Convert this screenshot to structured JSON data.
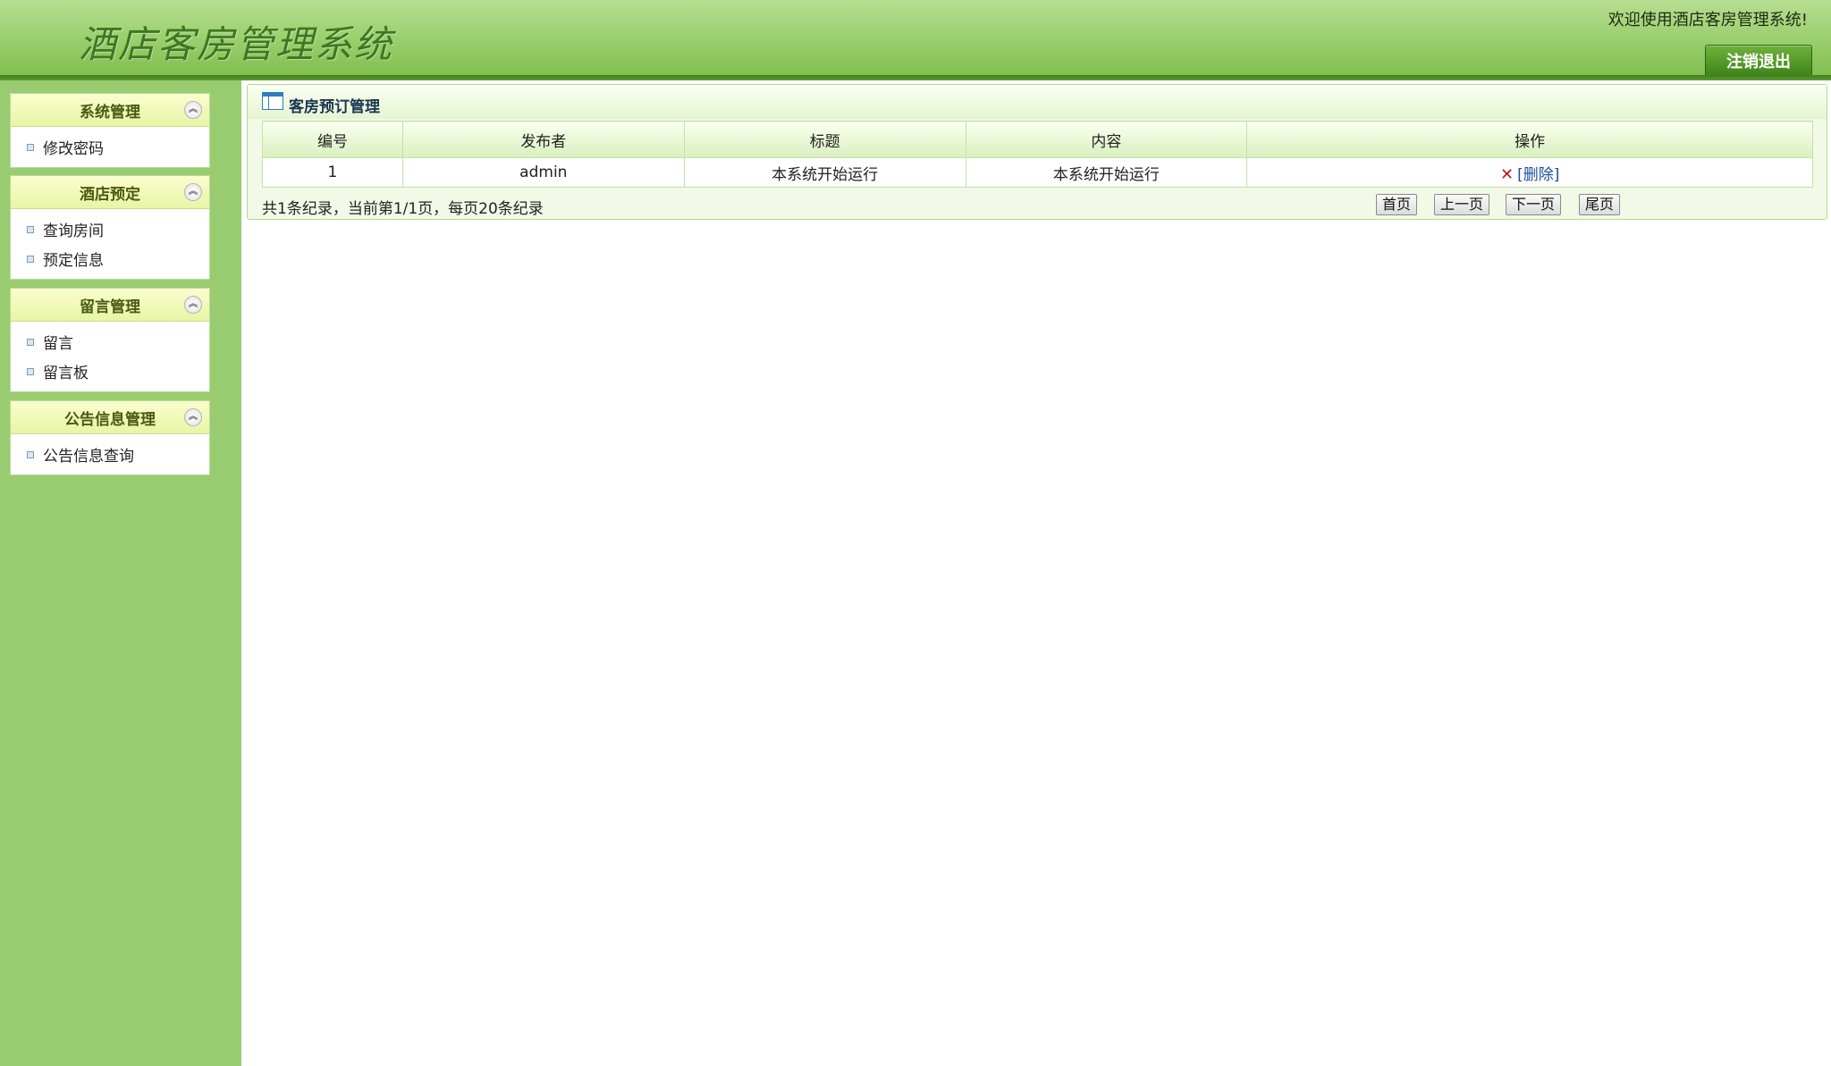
{
  "header": {
    "title": "酒店客房管理系统",
    "welcome": "欢迎使用酒店客房管理系统!",
    "logout_label": "注销退出"
  },
  "sidebar": {
    "groups": [
      {
        "title": "系统管理",
        "items": [
          "修改密码"
        ]
      },
      {
        "title": "酒店预定",
        "items": [
          "查询房间",
          "预定信息"
        ]
      },
      {
        "title": "留言管理",
        "items": [
          "留言",
          "留言板"
        ]
      },
      {
        "title": "公告信息管理",
        "items": [
          "公告信息查询"
        ]
      }
    ]
  },
  "main": {
    "panel_title": "客房预订管理",
    "table": {
      "columns": [
        "编号",
        "发布者",
        "标题",
        "内容",
        "操作"
      ],
      "rows": [
        {
          "id": "1",
          "publisher": "admin",
          "title": "本系统开始运行",
          "content": "本系统开始运行",
          "action": "[删除]"
        }
      ]
    },
    "pager": {
      "summary": "共1条纪录，当前第1/1页，每页20条纪录",
      "first": "首页",
      "prev": "上一页",
      "next": "下一页",
      "last": "尾页"
    }
  },
  "colors": {
    "header_green": "#9fd173",
    "sidebar_green": "#99cc70",
    "accent_dark_green": "#3f8418",
    "delete_red": "#c0141a"
  },
  "icons": {
    "collapse": "chevron-double-up-icon",
    "bullet": "square-bullet-icon",
    "panel": "table-icon",
    "delete": "red-x-icon"
  }
}
